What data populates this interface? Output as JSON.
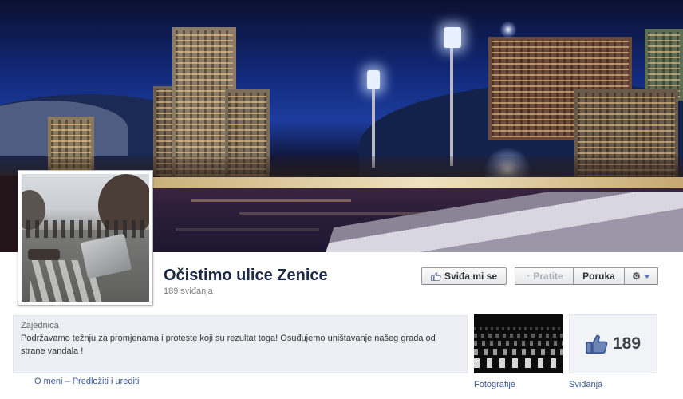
{
  "page": {
    "name": "Očistimo ulice Zenice",
    "likes_count_text": "189 sviđanja"
  },
  "actions": {
    "like_label": "Sviđa mi se",
    "follow_label": "Pratite",
    "message_label": "Poruka"
  },
  "about": {
    "category": "Zajednica",
    "description": "Podržavamo težnju za promjenama i proteste koji su rezultat toga! Osuđujemo uništavanje našeg grada od strane vandala !",
    "link_about": "O meni",
    "separator": "–",
    "link_suggest": "Predložiti i urediti"
  },
  "tiles": {
    "photos_label": "Fotografije",
    "likes_number": "189",
    "likes_label": "Sviđanja"
  },
  "colors": {
    "title": "#1c2a47",
    "link": "#3b5998",
    "about_bg": "#edeff4"
  },
  "icons": {
    "like_button": "thumbs-up-icon",
    "follow_button": "rss-icon",
    "settings_button": "gear-icon",
    "dropdown": "chevron-down-icon",
    "likes_tile": "thumbs-up-icon"
  }
}
